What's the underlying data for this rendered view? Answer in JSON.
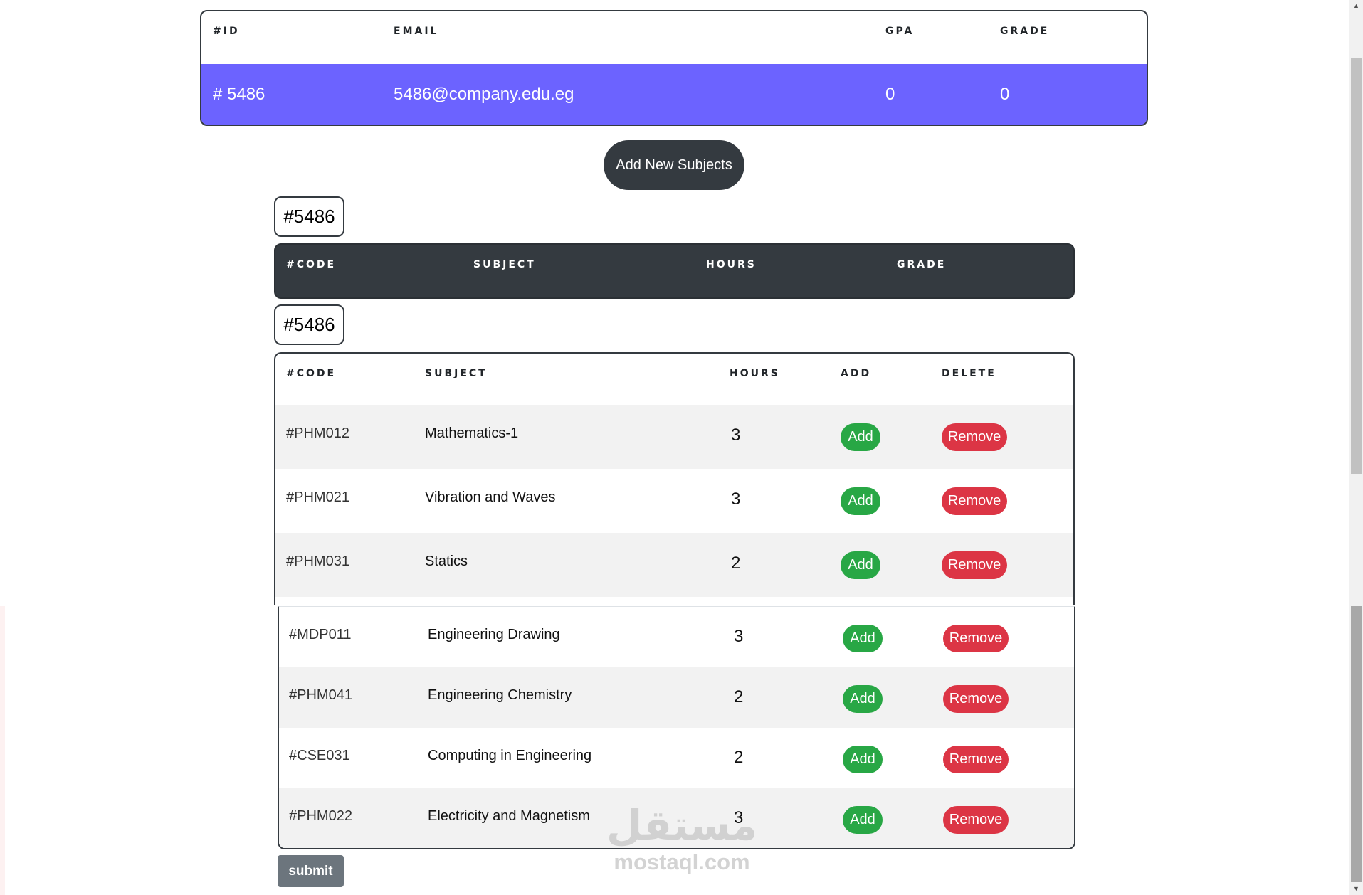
{
  "student_table": {
    "headers": [
      "#ID",
      "EMAIL",
      "GPA",
      "GRADE"
    ],
    "row": {
      "id": "# 5486",
      "email": "5486@company.edu.eg",
      "gpa": "0",
      "grade": "0"
    }
  },
  "add_subjects_button": "Add New Subjects",
  "student_badge_1": "#5486",
  "enrolled_table": {
    "headers": [
      "#CODE",
      "SUBJECT",
      "HOURS",
      "GRADE"
    ]
  },
  "student_badge_2": "#5486",
  "subjects_table": {
    "headers": [
      "#CODE",
      "SUBJECT",
      "HOURS",
      "ADD",
      "DELETE"
    ],
    "add_label": "Add",
    "remove_label": "Remove",
    "rows": [
      {
        "code": "#PHM012",
        "subject": "Mathematics-1",
        "hours": "3"
      },
      {
        "code": "#PHM021",
        "subject": "Vibration and Waves",
        "hours": "3"
      },
      {
        "code": "#PHM031",
        "subject": "Statics",
        "hours": "2"
      },
      {
        "code": "#MDP011",
        "subject": "Engineering Drawing",
        "hours": "3"
      },
      {
        "code": "#PHM041",
        "subject": "Engineering Chemistry",
        "hours": "2"
      },
      {
        "code": "#CSE031",
        "subject": "Computing in Engineering",
        "hours": "2"
      },
      {
        "code": "#PHM022",
        "subject": "Electricity and Magnetism",
        "hours": "3"
      }
    ]
  },
  "submit_button": "submit",
  "watermark": {
    "logo": "مستقل",
    "text": "mostaql.com"
  },
  "colors": {
    "accent": "#6c63ff",
    "dark": "#343a40",
    "success": "#28a745",
    "danger": "#dc3545",
    "secondary": "#6c757d"
  },
  "icons": {
    "scroll_up": "triangle-up-icon",
    "scroll_down": "triangle-down-icon"
  }
}
